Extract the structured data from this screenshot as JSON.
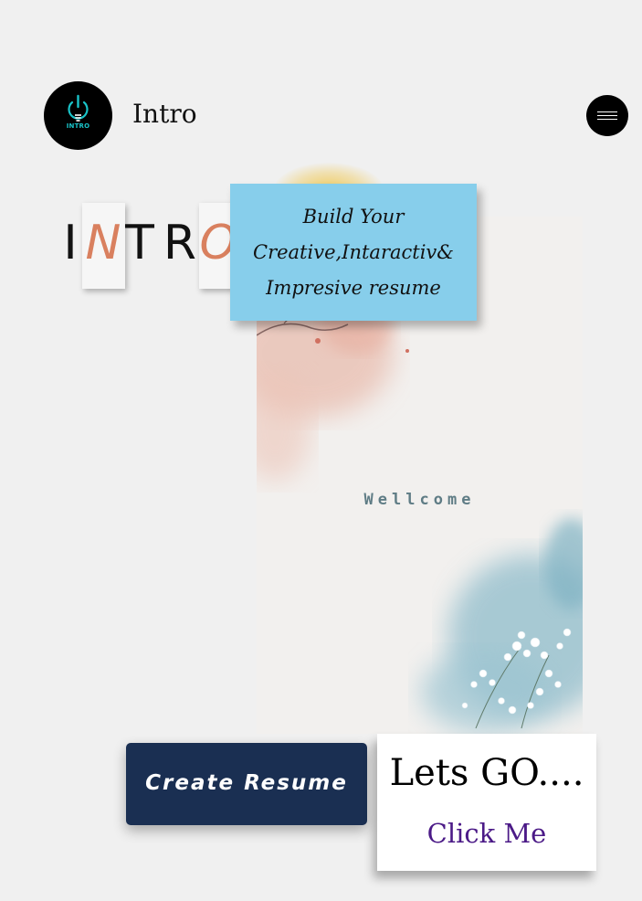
{
  "header": {
    "logo_text": "INTRO",
    "title": "Intro",
    "menu_icon": "hamburger-icon"
  },
  "hero": {
    "letters": [
      "I",
      "N",
      "T",
      "R",
      "O"
    ],
    "highlighted_letters": [
      1,
      4
    ],
    "highlight_color": "#d9805f"
  },
  "tagline": {
    "lines": [
      "Build Your",
      "Creative,Intaractiv&",
      "Impresive resume"
    ],
    "background": "#87ceeb"
  },
  "card": {
    "welcome_text": "Wellcome"
  },
  "actions": {
    "create_resume_label": "Create Resume",
    "lets_go_label": "Lets GO....",
    "click_me_label": "Click Me",
    "button_color": "#1a2f52",
    "link_color": "#4b1a87"
  }
}
